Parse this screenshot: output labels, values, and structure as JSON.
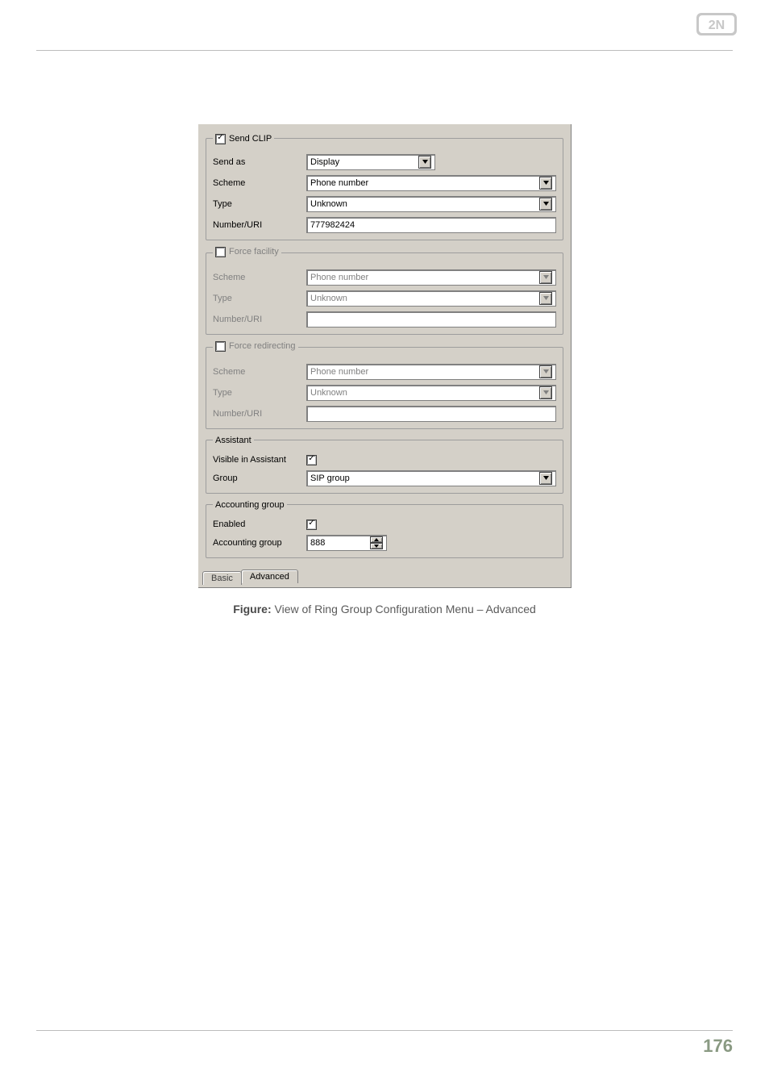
{
  "caption": {
    "label": "Figure:",
    "text": " View of Ring Group Configuration Menu – Advanced"
  },
  "page_number": "176",
  "form": {
    "send_clip": {
      "legend": "Send CLIP",
      "checked": true,
      "rows": {
        "send_as": {
          "label": "Send as",
          "value": "Display"
        },
        "scheme": {
          "label": "Scheme",
          "value": "Phone number"
        },
        "type": {
          "label": "Type",
          "value": "Unknown"
        },
        "number": {
          "label": "Number/URI",
          "value": "777982424"
        }
      }
    },
    "force_facility": {
      "legend": "Force facility",
      "checked": false,
      "rows": {
        "scheme": {
          "label": "Scheme",
          "value": "Phone number"
        },
        "type": {
          "label": "Type",
          "value": "Unknown"
        },
        "number": {
          "label": "Number/URI",
          "value": ""
        }
      }
    },
    "force_redirecting": {
      "legend": "Force redirecting",
      "checked": false,
      "rows": {
        "scheme": {
          "label": "Scheme",
          "value": "Phone number"
        },
        "type": {
          "label": "Type",
          "value": "Unknown"
        },
        "number": {
          "label": "Number/URI",
          "value": ""
        }
      }
    },
    "assistant": {
      "legend": "Assistant",
      "rows": {
        "visible": {
          "label": "Visible in Assistant",
          "checked": true
        },
        "group": {
          "label": "Group",
          "value": "SIP group"
        }
      }
    },
    "accounting": {
      "legend": "Accounting group",
      "rows": {
        "enabled": {
          "label": "Enabled",
          "checked": true
        },
        "group": {
          "label": "Accounting group",
          "value": "888"
        }
      }
    },
    "tabs": {
      "basic": "Basic",
      "advanced": "Advanced"
    }
  }
}
